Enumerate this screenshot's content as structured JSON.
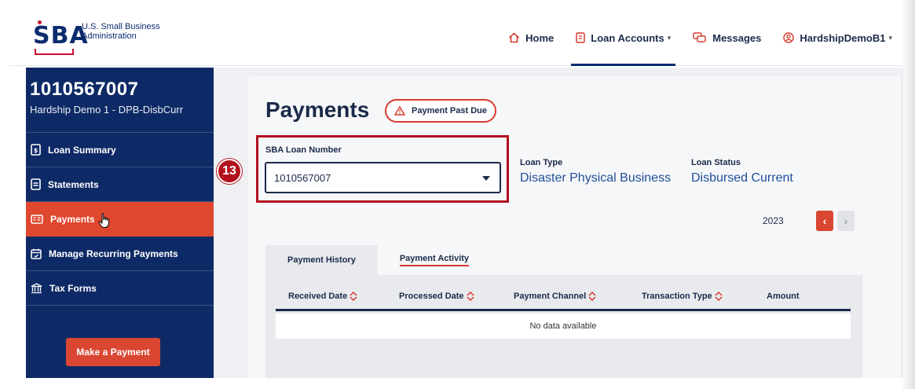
{
  "header": {
    "logo_letters": "SBA",
    "logo_text_line1": "U.S. Small Business",
    "logo_text_line2": "Administration",
    "nav": {
      "home": "Home",
      "loan_accounts": "Loan Accounts",
      "messages": "Messages",
      "user": "HardshipDemoB1"
    }
  },
  "sidebar": {
    "loan_number": "1010567007",
    "loan_subtitle": "Hardship Demo 1 - DPB-DisbCurr",
    "items": [
      {
        "label": "Loan Summary",
        "icon": "loan-summary-icon"
      },
      {
        "label": "Statements",
        "icon": "statements-icon"
      },
      {
        "label": "Payments",
        "icon": "payments-icon"
      },
      {
        "label": "Manage Recurring Payments",
        "icon": "calendar-icon"
      },
      {
        "label": "Tax Forms",
        "icon": "bank-icon"
      }
    ],
    "make_payment": "Make a Payment"
  },
  "main": {
    "title": "Payments",
    "badge": "Payment Past Due",
    "step_number": "13",
    "loan_number_label": "SBA Loan Number",
    "loan_number_value": "1010567007",
    "loan_type_label": "Loan Type",
    "loan_type_value": "Disaster Physical Business",
    "loan_status_label": "Loan Status",
    "loan_status_value": "Disbursed Current",
    "year": "2023",
    "tabs": [
      "Payment History",
      "Payment Activity"
    ],
    "columns": [
      "Received Date",
      "Processed Date",
      "Payment Channel",
      "Transaction Type",
      "Amount"
    ],
    "empty_text": "No data available"
  },
  "colors": {
    "navy": "#0e2a66",
    "accent_red": "#d94632",
    "callout_red": "#b3111e",
    "link_blue": "#1f4e9c"
  }
}
